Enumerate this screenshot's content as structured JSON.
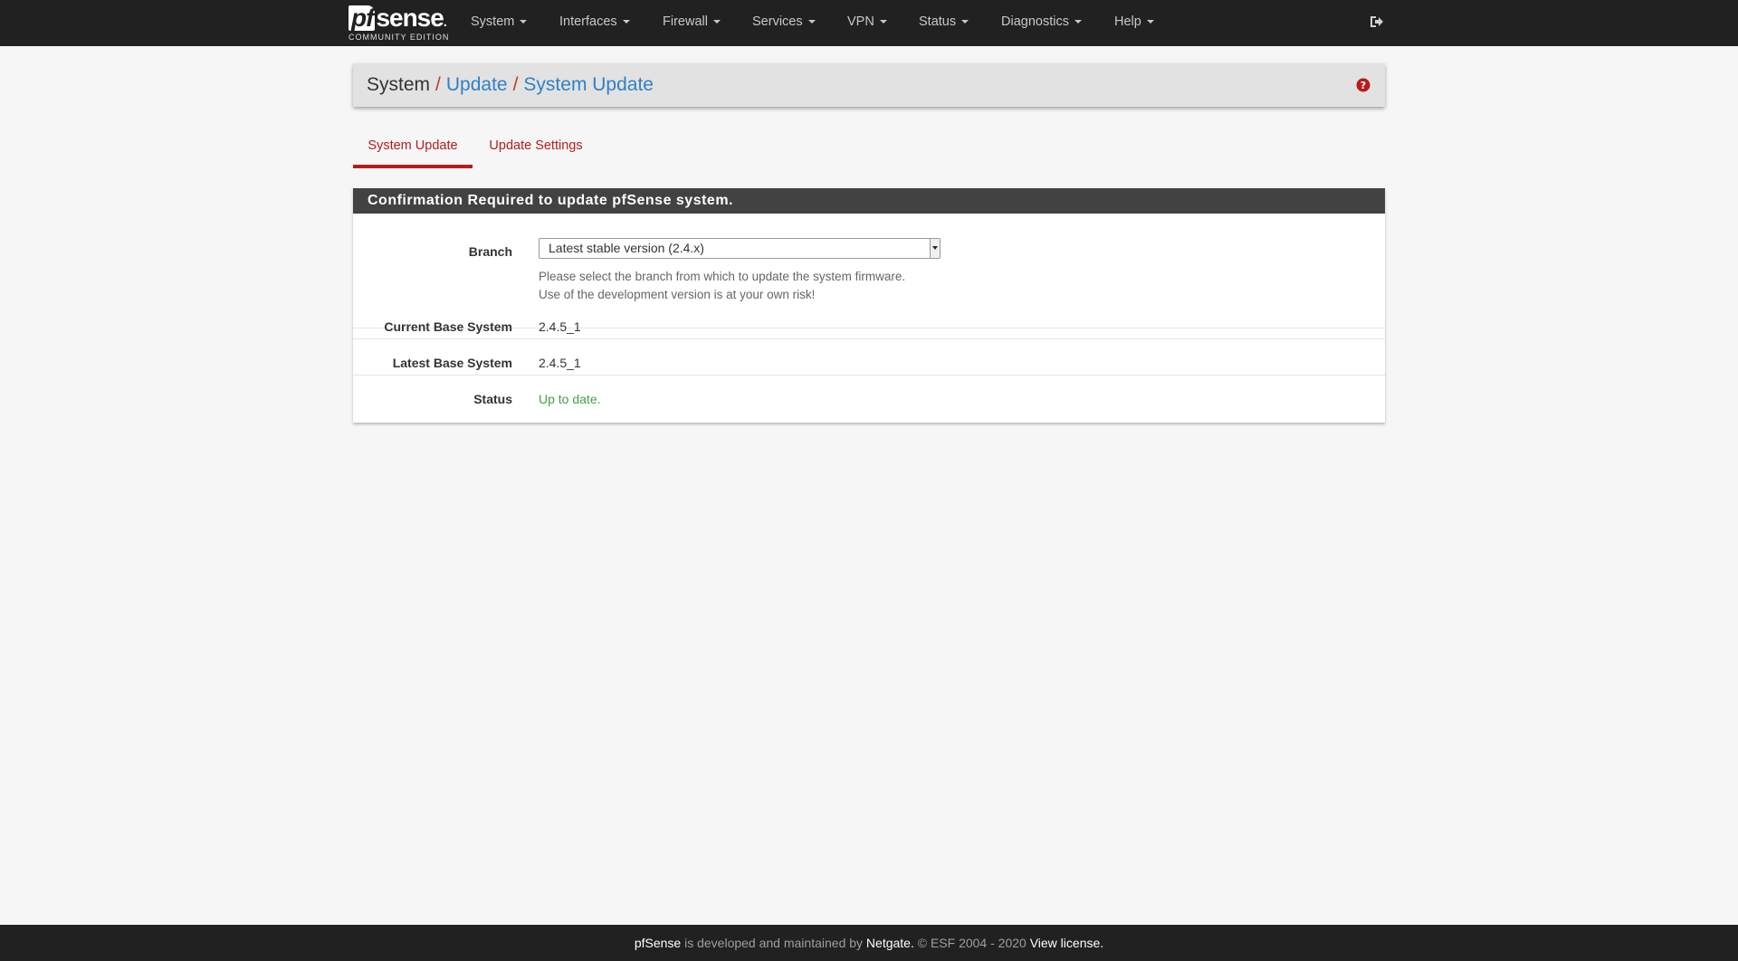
{
  "brand": {
    "logo_pf": "pf",
    "logo_sense": "sense",
    "subtitle": "COMMUNITY EDITION"
  },
  "nav": {
    "items": [
      {
        "label": "System"
      },
      {
        "label": "Interfaces"
      },
      {
        "label": "Firewall"
      },
      {
        "label": "Services"
      },
      {
        "label": "VPN"
      },
      {
        "label": "Status"
      },
      {
        "label": "Diagnostics"
      },
      {
        "label": "Help"
      }
    ],
    "logout_icon": "sign-out-icon"
  },
  "breadcrumb": {
    "root": "System",
    "separator": "/",
    "level1": "Update",
    "level2": "System Update",
    "help_icon": "question-circle-icon"
  },
  "tabs": [
    {
      "label": "System Update",
      "active": true
    },
    {
      "label": "Update Settings",
      "active": false
    }
  ],
  "panel": {
    "heading": "Confirmation Required to update pfSense system.",
    "branch": {
      "label": "Branch",
      "selected": "Latest stable version (2.4.x)",
      "help_line1": "Please select the branch from which to update the system firmware.",
      "help_line2": "Use of the development version is at your own risk!"
    },
    "current_base": {
      "label": "Current Base System",
      "value": "2.4.5_1"
    },
    "latest_base": {
      "label": "Latest Base System",
      "value": "2.4.5_1"
    },
    "status": {
      "label": "Status",
      "value": "Up to date."
    }
  },
  "footer": {
    "product": "pfSense",
    "text1": " is developed and maintained by ",
    "company": "Netgate.",
    "text2": " © ESF 2004 - 2020 ",
    "license_link": "View license."
  },
  "colors": {
    "navbar_bg": "#212121",
    "accent_red": "#b71c1c",
    "link_blue": "#3080c8",
    "status_green": "#43a047",
    "panel_heading_bg": "#424242"
  }
}
